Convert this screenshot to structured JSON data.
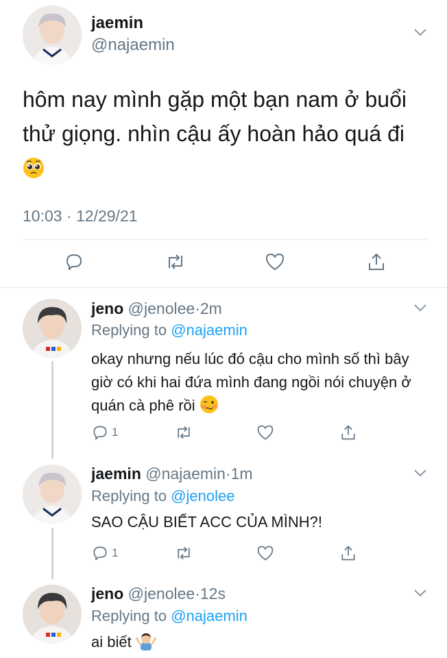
{
  "main_tweet": {
    "name": "jaemin",
    "handle": "@najaemin",
    "text": "hôm nay mình gặp một bạn nam ở buổi thử giọng. nhìn cậu ấy hoàn hảo quá đi",
    "emoji": "pleading-face",
    "timestamp": "10:03 · 12/29/21"
  },
  "replies": [
    {
      "name": "jeno",
      "handle": "@jenolee",
      "sep": "·",
      "time": "2m",
      "replying_prefix": "Replying to",
      "replying_to": "@najaemin",
      "text": "okay nhưng nếu lúc đó cậu cho mình số thì bây giờ có khi hai đứa mình đang ngồi nói chuyện ở quán cà phê rồi",
      "emoji": "woozy-face",
      "reply_count": "1"
    },
    {
      "name": "jaemin",
      "handle": "@najaemin",
      "sep": "·",
      "time": "1m",
      "replying_prefix": "Replying to",
      "replying_to": "@jenolee",
      "text": "SAO CẬU BIẾT ACC CỦA MÌNH?!",
      "reply_count": "1"
    },
    {
      "name": "jeno",
      "handle": "@jenolee",
      "sep": "·",
      "time": "12s",
      "replying_prefix": "Replying to",
      "replying_to": "@najaemin",
      "text": "ai biết",
      "emoji": "person-shrugging"
    }
  ],
  "colors": {
    "link": "#1da1f2",
    "secondary_text": "#657786",
    "divider": "#e1e8ed",
    "thread_line": "#ccd6dd"
  }
}
